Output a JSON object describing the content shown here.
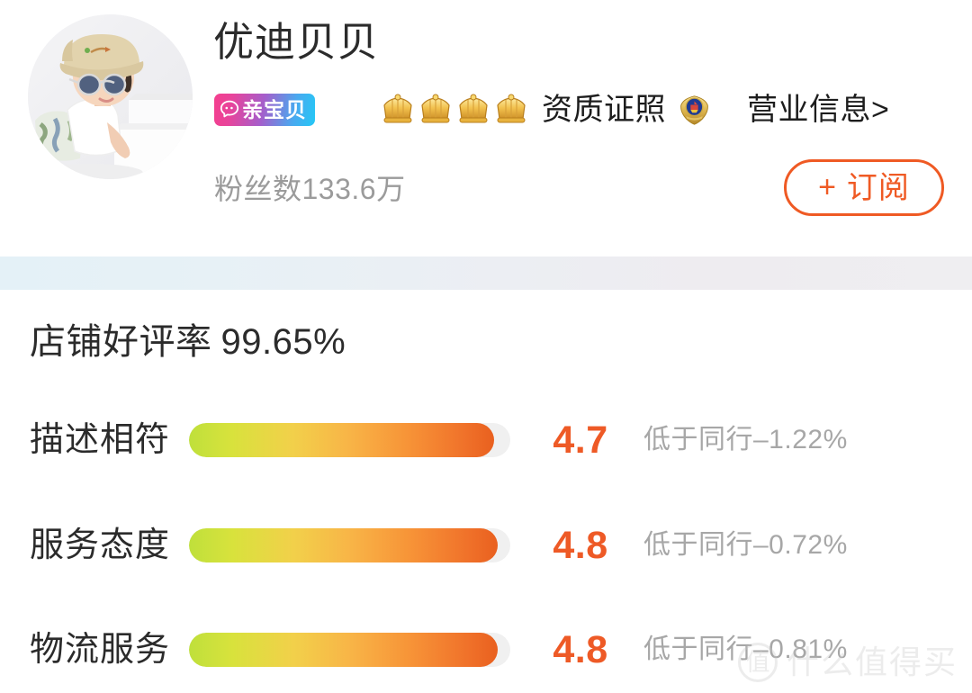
{
  "shop": {
    "name": "优迪贝贝",
    "avatar_alt": "baby-in-bucket-hat-avatar",
    "brand_badge": {
      "label": "亲宝贝",
      "icon": "speech-bubble-icon",
      "gradient_from": "#f53f8e",
      "gradient_to": "#24c8f6"
    },
    "crown_count": 4,
    "crown_icon": "crown-icon",
    "certification_label": "资质证照",
    "police_badge_icon": "police-badge-icon",
    "business_info_label": "营业信息>",
    "fans_label": "粉丝数133.6万",
    "subscribe": {
      "plus": "+",
      "label": "订阅",
      "color": "#ef5a24"
    }
  },
  "ratings": {
    "overall_label": "店铺好评率",
    "overall_value": "99.65%",
    "score_color": "#ee5a26",
    "compare_color": "#a7a7a7",
    "rows": [
      {
        "label": "描述相符",
        "score": "4.7",
        "compare": "低于同行–1.22%",
        "fill_percent": 95
      },
      {
        "label": "服务态度",
        "score": "4.8",
        "compare": "低于同行–0.72%",
        "fill_percent": 96
      },
      {
        "label": "物流服务",
        "score": "4.8",
        "compare": "低于同行–0.81%",
        "fill_percent": 96
      }
    ]
  },
  "watermark": {
    "mark": "值",
    "text": "什么值得买"
  }
}
